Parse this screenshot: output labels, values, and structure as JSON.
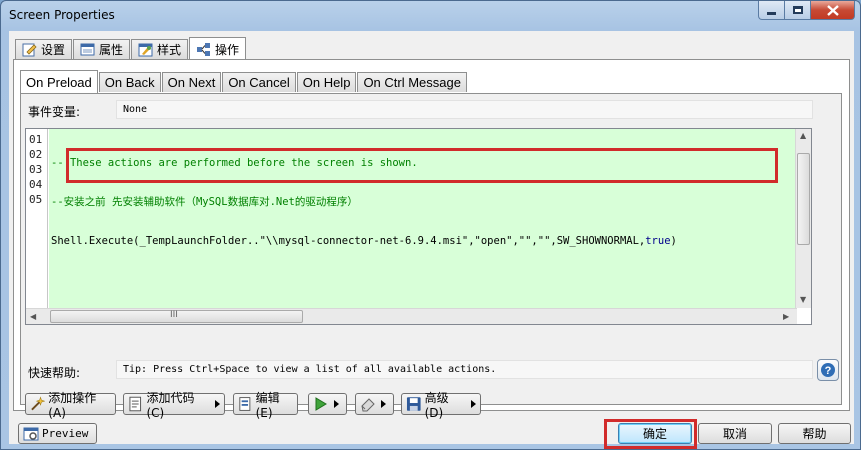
{
  "window": {
    "title": "Screen Properties"
  },
  "top_tabs": [
    {
      "label": "设置",
      "icon": "edit-icon"
    },
    {
      "label": "属性",
      "icon": "window-icon"
    },
    {
      "label": "样式",
      "icon": "style-icon"
    },
    {
      "label": "操作",
      "icon": "actions-icon",
      "active": true
    }
  ],
  "inner_tabs": [
    {
      "label": "On Preload",
      "active": true
    },
    {
      "label": "On Back"
    },
    {
      "label": "On Next"
    },
    {
      "label": "On Cancel"
    },
    {
      "label": "On Help"
    },
    {
      "label": "On Ctrl Message"
    }
  ],
  "event_var": {
    "label": "事件变量:",
    "value": "None"
  },
  "editor": {
    "line_numbers": [
      "01",
      "02",
      "03",
      "04",
      "05"
    ],
    "lines": [
      "-- These actions are performed before the screen is shown.",
      "--安装之前 先安装辅助软件（MySQL数据库对.Net的驱动程序）",
      "Shell.Execute(_TempLaunchFolder..\"\\\\mysql-connector-net-6.9.4.msi\",\"open\",\"\",\"\",SW_SHOWNORMAL,",
      "",
      ""
    ],
    "line3_keyword": "true",
    "line3_close": ")",
    "scroll_grip": "III",
    "background": "#d8ffd8",
    "highlight_color": "#d12b2b"
  },
  "quick_help": {
    "label": "快速帮助:",
    "value": "Tip: Press Ctrl+Space to view a list of all available actions."
  },
  "toolbar": {
    "add_action": "添加操作(A)",
    "add_code": "添加代码(C)",
    "edit": "编辑(E)",
    "advanced": "高级(D)"
  },
  "bottom": {
    "preview": "Preview",
    "ok": "确定",
    "cancel": "取消",
    "help": "帮助"
  }
}
